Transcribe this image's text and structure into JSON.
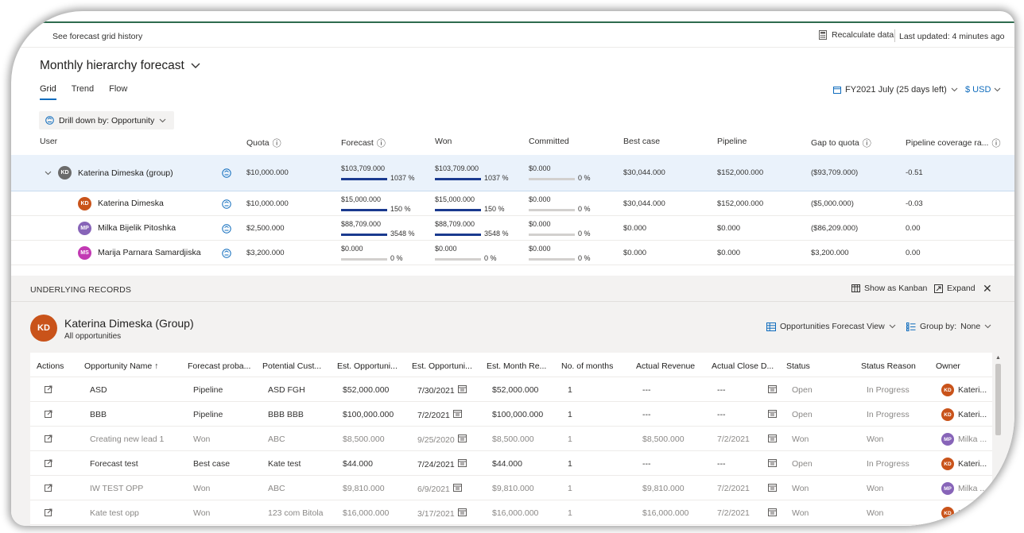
{
  "topbar": {
    "history_link": "See forecast grid history",
    "recalc_label": "Recalculate data",
    "last_updated": "Last updated: 4 minutes ago"
  },
  "forecast": {
    "title": "Monthly hierarchy forecast",
    "tabs": [
      {
        "label": "Grid",
        "active": true
      },
      {
        "label": "Trend",
        "active": false
      },
      {
        "label": "Flow",
        "active": false
      }
    ],
    "period": "FY2021 July (25 days left)",
    "currency": "$ USD",
    "drill_label": "Drill down by: Opportunity"
  },
  "grid": {
    "headers": {
      "user": "User",
      "quota": "Quota",
      "forecast": "Forecast",
      "won": "Won",
      "committed": "Committed",
      "best_case": "Best case",
      "pipeline": "Pipeline",
      "gap": "Gap to quota",
      "coverage": "Pipeline coverage ra..."
    },
    "rows": [
      {
        "initials": "KD",
        "name": "Katerina Dimeska (group)",
        "color": "#6b6b6b",
        "quota": "$10,000.000",
        "forecast": {
          "amount": "$103,709.000",
          "pct": "1037 %",
          "fill": 1.0
        },
        "won": {
          "amount": "$103,709.000",
          "pct": "1037 %",
          "fill": 1.0
        },
        "committed": {
          "amount": "$0.000",
          "pct": "0 %",
          "fill": 0.0
        },
        "best_case": "$30,044.000",
        "pipeline": "$152,000.000",
        "gap": "($93,709.000)",
        "coverage": "-0.51"
      },
      {
        "initials": "KD",
        "name": "Katerina Dimeska",
        "color": "#c9531a",
        "quota": "$10,000.000",
        "forecast": {
          "amount": "$15,000.000",
          "pct": "150 %",
          "fill": 1.0
        },
        "won": {
          "amount": "$15,000.000",
          "pct": "150 %",
          "fill": 1.0
        },
        "committed": {
          "amount": "$0.000",
          "pct": "0 %",
          "fill": 0.0
        },
        "best_case": "$30,044.000",
        "pipeline": "$152,000.000",
        "gap": "($5,000.000)",
        "coverage": "-0.03"
      },
      {
        "initials": "MP",
        "name": "Milka Bijelik Pitoshka",
        "color": "#8764b8",
        "quota": "$2,500.000",
        "forecast": {
          "amount": "$88,709.000",
          "pct": "3548 %",
          "fill": 1.0
        },
        "won": {
          "amount": "$88,709.000",
          "pct": "3548 %",
          "fill": 1.0
        },
        "committed": {
          "amount": "$0.000",
          "pct": "0 %",
          "fill": 0.0
        },
        "best_case": "$0.000",
        "pipeline": "$0.000",
        "gap": "($86,209.000)",
        "coverage": "0.00"
      },
      {
        "initials": "MS",
        "name": "Marija Parnara Samardjiska",
        "color": "#c239b3",
        "quota": "$3,200.000",
        "forecast": {
          "amount": "$0.000",
          "pct": "0 %",
          "fill": 0.0
        },
        "won": {
          "amount": "$0.000",
          "pct": "0 %",
          "fill": 0.0
        },
        "committed": {
          "amount": "$0.000",
          "pct": "0 %",
          "fill": 0.0
        },
        "best_case": "$0.000",
        "pipeline": "$0.000",
        "gap": "$3,200.000",
        "coverage": "0.00"
      }
    ]
  },
  "underlying": {
    "title": "UNDERLYING RECORDS",
    "kanban_label": "Show as Kanban",
    "expand_label": "Expand",
    "owner_initials": "KD",
    "owner_name": "Katerina Dimeska (Group)",
    "subtitle": "All opportunities",
    "view_label": "Opportunities Forecast View",
    "group_by": "Group by:",
    "group_value": "None",
    "columns": {
      "actions": "Actions",
      "name": "Opportunity Name",
      "prob": "Forecast proba...",
      "customer": "Potential Cust...",
      "est1": "Est. Opportuni...",
      "est2": "Est. Opportuni...",
      "month_rev": "Est. Month Re...",
      "months": "No. of months",
      "actual_rev": "Actual Revenue",
      "close": "Actual Close D...",
      "status": "Status",
      "reason": "Status Reason",
      "owner": "Owner"
    },
    "records": [
      {
        "name": "ASD",
        "prob": "Pipeline",
        "customer": "ASD FGH",
        "est1": "$52,000.000",
        "date": "7/30/2021",
        "month_rev": "$52,000.000",
        "months": "1",
        "actual_rev": "---",
        "close": "---",
        "status": "Open",
        "reason": "In Progress",
        "owner_initials": "KD",
        "owner": "Kateri...",
        "owner_color": "#c9531a",
        "won": false
      },
      {
        "name": "BBB",
        "prob": "Pipeline",
        "customer": "BBB BBB",
        "est1": "$100,000.000",
        "date": "7/2/2021",
        "month_rev": "$100,000.000",
        "months": "1",
        "actual_rev": "---",
        "close": "---",
        "status": "Open",
        "reason": "In Progress",
        "owner_initials": "KD",
        "owner": "Kateri...",
        "owner_color": "#c9531a",
        "won": false
      },
      {
        "name": "Creating new lead 1",
        "prob": "Won",
        "customer": "ABC",
        "est1": "$8,500.000",
        "date": "9/25/2020",
        "month_rev": "$8,500.000",
        "months": "1",
        "actual_rev": "$8,500.000",
        "close": "7/2/2021",
        "status": "Won",
        "reason": "Won",
        "owner_initials": "MP",
        "owner": "Milka ...",
        "owner_color": "#8764b8",
        "won": true
      },
      {
        "name": "Forecast test",
        "prob": "Best case",
        "customer": "Kate test",
        "est1": "$44.000",
        "date": "7/24/2021",
        "month_rev": "$44.000",
        "months": "1",
        "actual_rev": "---",
        "close": "---",
        "status": "Open",
        "reason": "In Progress",
        "owner_initials": "KD",
        "owner": "Kateri...",
        "owner_color": "#c9531a",
        "won": false
      },
      {
        "name": "IW TEST OPP",
        "prob": "Won",
        "customer": "ABC",
        "est1": "$9,810.000",
        "date": "6/9/2021",
        "month_rev": "$9,810.000",
        "months": "1",
        "actual_rev": "$9,810.000",
        "close": "7/2/2021",
        "status": "Won",
        "reason": "Won",
        "owner_initials": "MP",
        "owner": "Milka ...",
        "owner_color": "#8764b8",
        "won": true
      },
      {
        "name": "Kate test opp",
        "prob": "Won",
        "customer": "123 com Bitola",
        "est1": "$16,000.000",
        "date": "3/17/2021",
        "month_rev": "$16,000.000",
        "months": "1",
        "actual_rev": "$16,000.000",
        "close": "7/2/2021",
        "status": "Won",
        "reason": "Won",
        "owner_initials": "KD",
        "owner": "Kateri...",
        "owner_color": "#c9531a",
        "won": true
      }
    ]
  }
}
